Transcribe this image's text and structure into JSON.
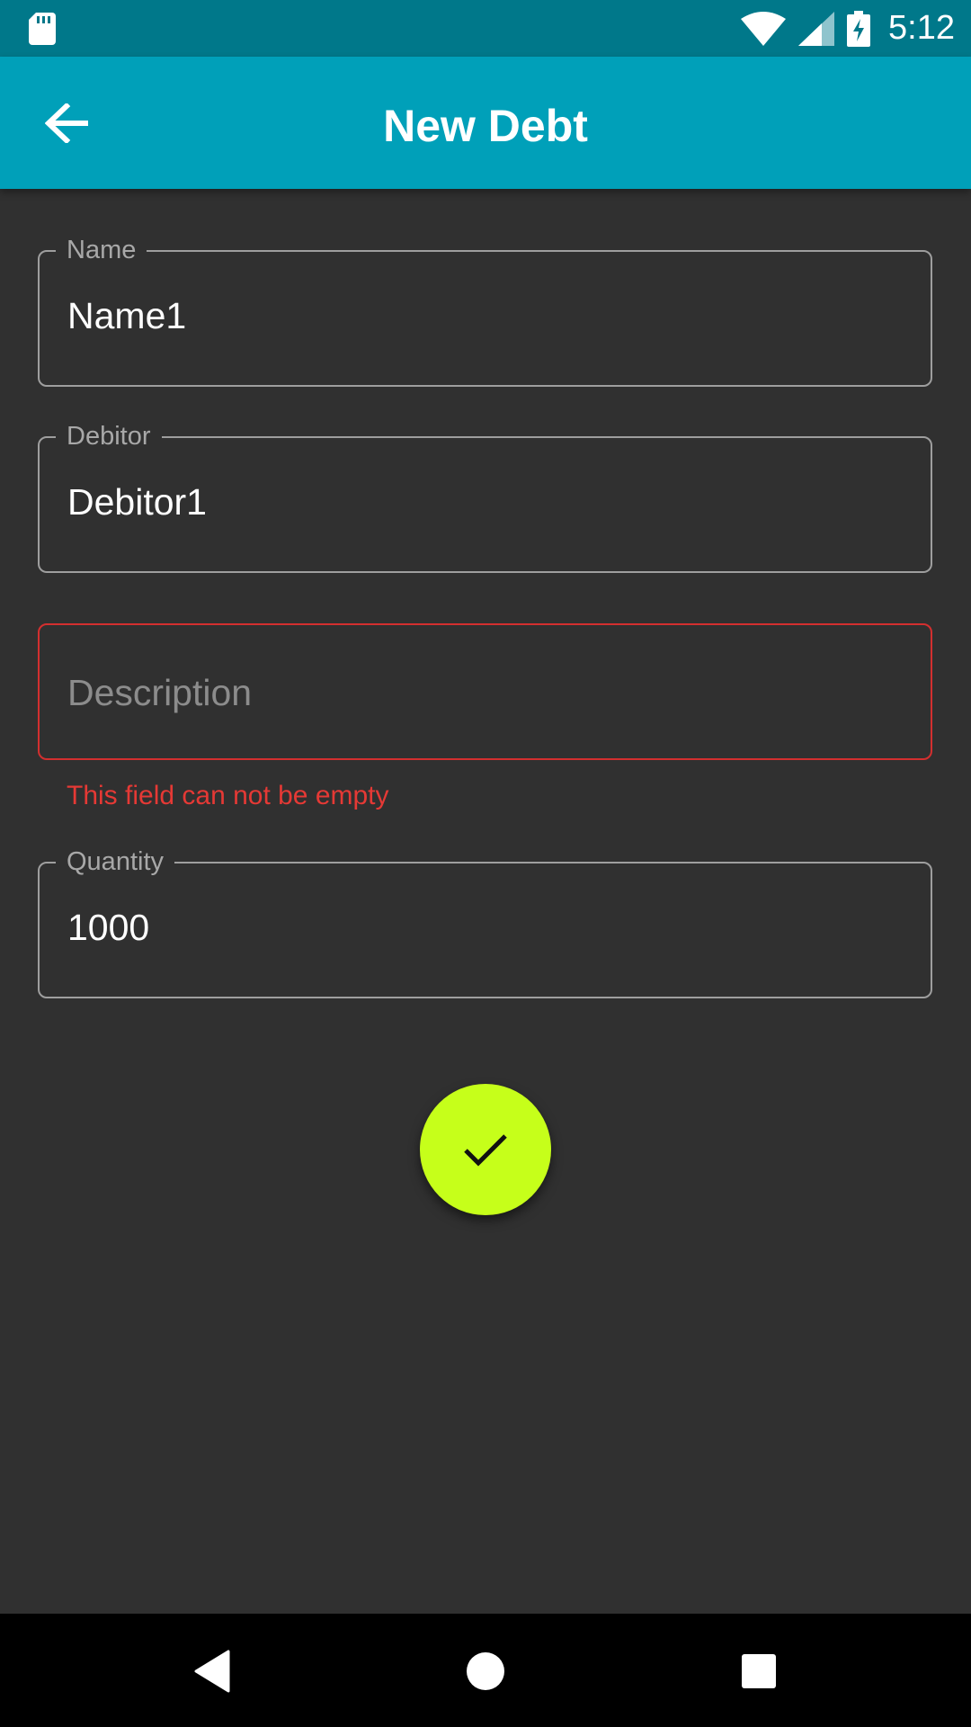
{
  "status_bar": {
    "time": "5:12",
    "icons": [
      "sd-card-icon",
      "wifi-icon",
      "signal-icon",
      "battery-charging-icon"
    ]
  },
  "app_bar": {
    "title": "New Debt",
    "back_icon": "arrow-back-icon"
  },
  "form": {
    "name": {
      "label": "Name",
      "value": "Name1"
    },
    "debitor": {
      "label": "Debitor",
      "value": "Debitor1"
    },
    "description": {
      "placeholder": "Description",
      "value": "",
      "error": "This field can not be empty"
    },
    "quantity": {
      "label": "Quantity",
      "value": "1000"
    }
  },
  "fab": {
    "icon": "check-icon"
  },
  "nav_bar": {
    "icons": [
      "back-triangle-icon",
      "home-circle-icon",
      "recents-square-icon"
    ]
  },
  "colors": {
    "status_bar": "#00788a",
    "app_bar": "#00a0b9",
    "background": "#303030",
    "error": "#d32f2f",
    "fab": "#c6ff1a"
  }
}
